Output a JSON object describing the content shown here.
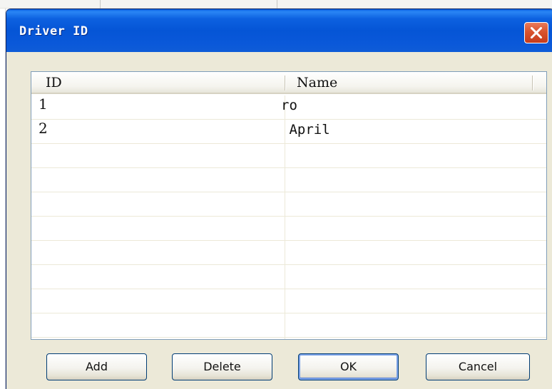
{
  "dialog": {
    "title": "Driver ID"
  },
  "list": {
    "columns": [
      "ID",
      "Name"
    ],
    "rows": [
      {
        "id": "1",
        "name": "ro"
      },
      {
        "id": "2",
        "name": " April"
      }
    ]
  },
  "buttons": {
    "add": "Add",
    "delete": "Delete",
    "ok": "OK",
    "cancel": "Cancel"
  },
  "icons": {
    "close": "close-icon"
  },
  "colors": {
    "titlebar": "#0555d6",
    "close_button": "#d9542e",
    "dialog_face": "#ece9d8",
    "focus_ring": "#7ba2e7"
  }
}
